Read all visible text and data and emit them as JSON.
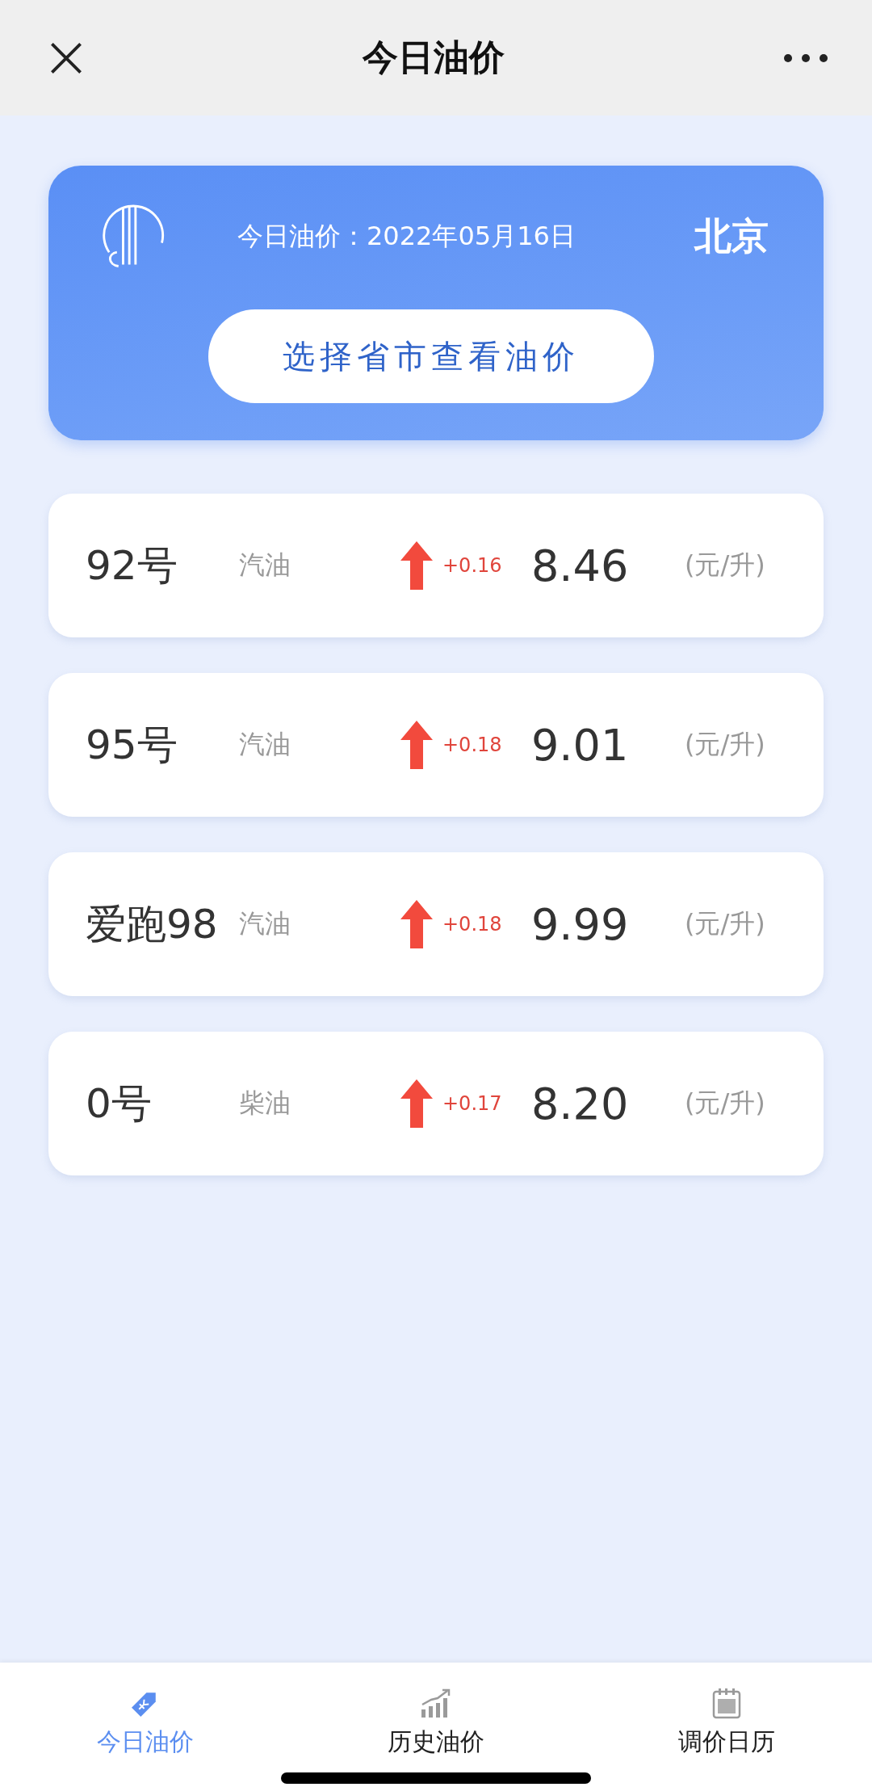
{
  "header": {
    "title": "今日油价"
  },
  "banner": {
    "date_text": "今日油价：2022年05月16日",
    "city": "北京",
    "button": "选择省市查看油价"
  },
  "prices": [
    {
      "name": "92号",
      "type": "汽油",
      "kind": "up",
      "change": "+0.16",
      "price": "8.46",
      "unit": "(元/升)"
    },
    {
      "name": "95号",
      "type": "汽油",
      "kind": "up",
      "change": "+0.18",
      "price": "9.01",
      "unit": "(元/升)"
    },
    {
      "name": "爱跑98",
      "type": "汽油",
      "kind": "up",
      "change": "+0.18",
      "price": "9.99",
      "unit": "(元/升)"
    },
    {
      "name": "0号",
      "type": "柴油",
      "kind": "up",
      "change": "+0.17",
      "price": "8.20",
      "unit": "(元/升)"
    }
  ],
  "tabs": [
    {
      "label": "今日油价",
      "selected": true
    },
    {
      "label": "历史油价",
      "selected": false
    },
    {
      "label": "调价日历",
      "selected": false
    }
  ]
}
